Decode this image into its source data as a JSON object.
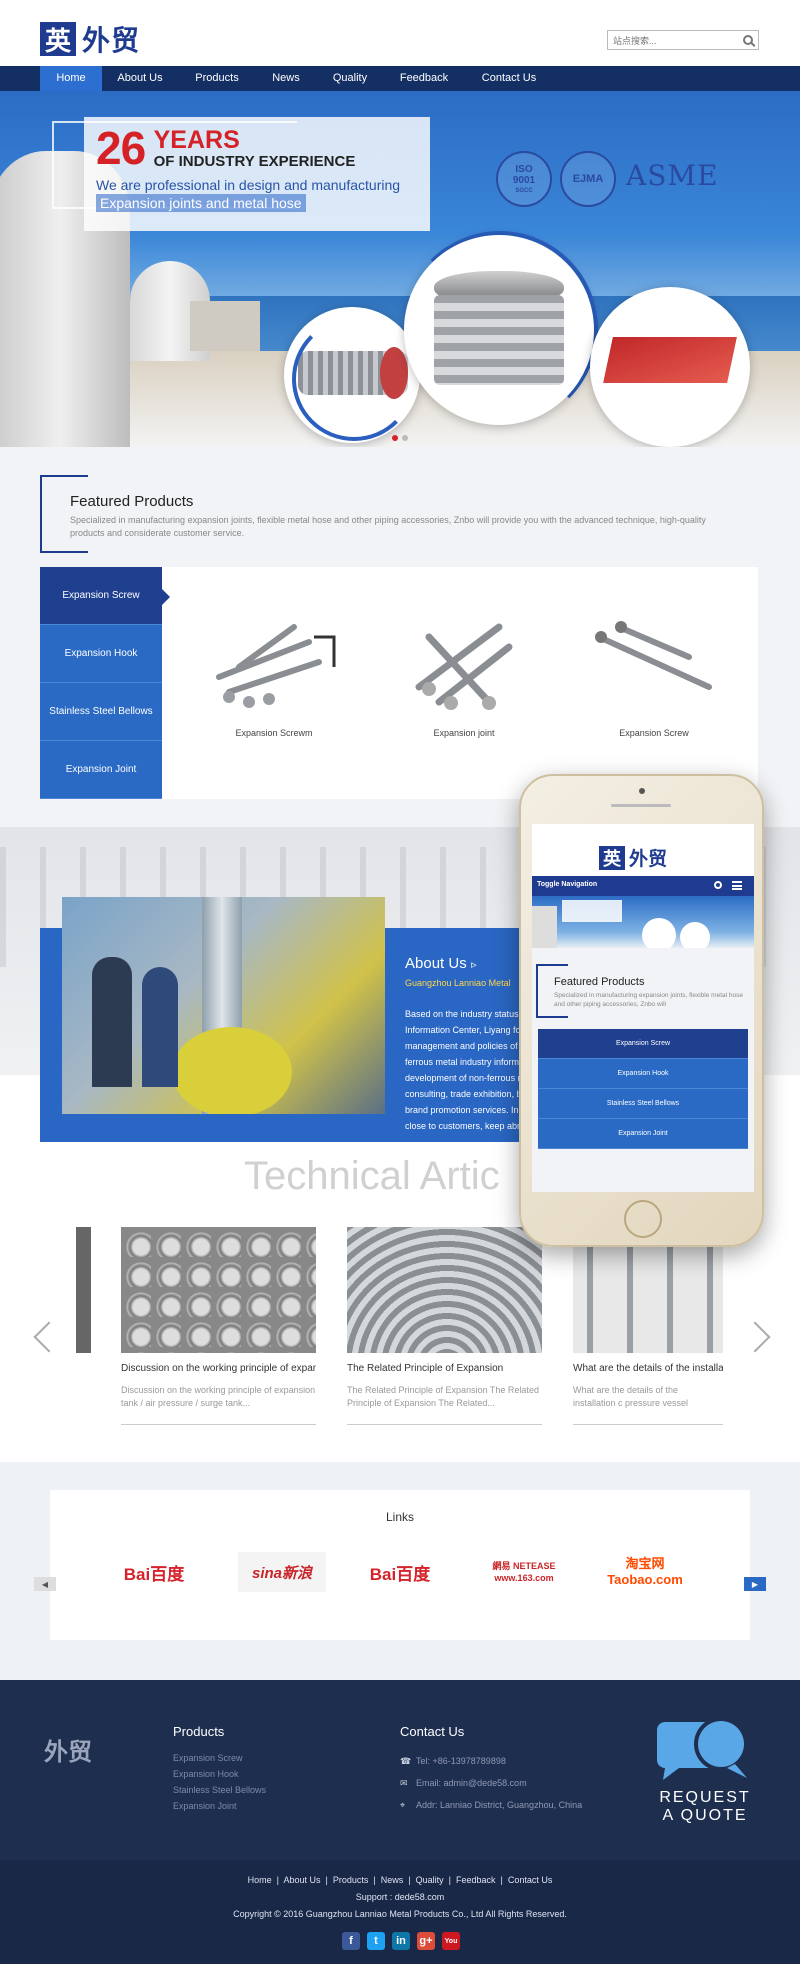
{
  "header": {
    "logo_char": "英",
    "logo_text": "外贸",
    "search_placeholder": "站点搜索..."
  },
  "nav": {
    "items": [
      {
        "label": "Home",
        "active": true
      },
      {
        "label": "About Us"
      },
      {
        "label": "Products"
      },
      {
        "label": "News"
      },
      {
        "label": "Quality"
      },
      {
        "label": "Feedback"
      },
      {
        "label": "Contact Us"
      }
    ]
  },
  "banner": {
    "years": "26",
    "years_word": "YEARS",
    "experience": "OF INDUSTRY EXPERIENCE",
    "line1": "We are professional in design and manufacturing",
    "line2": "Expansion joints and metal hose",
    "cert1": "ISO 9001",
    "cert1_sub": "SGCC",
    "cert2": "EJMA",
    "brand": "ASME"
  },
  "featured": {
    "title": "Featured Products",
    "description": "Specialized in manufacturing expansion joints, flexible metal hose and other piping accessories, Znbo will provide you with the advanced technique, high-quality products and considerate customer service.",
    "tabs": [
      "Expansion Screw",
      "Expansion Hook",
      "Stainless Steel Bellows",
      "Expansion Joint"
    ],
    "products": [
      "Expansion Screwm",
      "Expansion joint",
      "Expansion Screw"
    ]
  },
  "about": {
    "title": "About Us",
    "arrow": "▹",
    "subtitle": "Guangzhou Lanniao Metal",
    "lines": [
      "Based on the industry status a",
      "Information Center, Liyang fo",
      "management and policies of t",
      "ferrous metal industry informa",
      "development of non-ferrous m",
      "consulting, trade exhibition, b",
      "brand promotion services. In t",
      "close to customers, keep abre"
    ]
  },
  "technical": {
    "title": "Technical Artic",
    "articles": [
      {
        "title": "Discussion on the working principle of expansi",
        "desc": "Discussion on the working principle of expansion tank / air pressure / surge tank..."
      },
      {
        "title": "The Related Principle of Expansion",
        "desc": "The Related Principle of Expansion The Related Principle of Expansion The Related..."
      },
      {
        "title": "What are the details of the installatio",
        "desc": "What are the details of the installation c pressure vessel expansion joint? ..."
      }
    ]
  },
  "links": {
    "title": "Links",
    "logos": [
      "Bai百度",
      "sina新浪",
      "Bai百度",
      "網易 NETEASE www.163.com",
      "淘宝网 Taobao.com"
    ]
  },
  "footer": {
    "logo": "外贸",
    "products_title": "Products",
    "products": [
      "Expansion Screw",
      "Expansion Hook",
      "Stainless Steel Bellows",
      "Expansion Joint"
    ],
    "contact_title": "Contact Us",
    "tel": "Tel: +86-13978789898",
    "email": "Email: admin@dede58.com",
    "addr": "Addr: Lanniao District, Guangzhou, China",
    "quote1": "REQUEST",
    "quote2": "A QUOTE",
    "bottom_links": [
      "Home",
      "About Us",
      "Products",
      "News",
      "Quality",
      "Feedback",
      "Contact Us"
    ],
    "support": "Support : dede58.com",
    "copyright": "Copyright © 2016 Guangzhou Lanniao Metal Products Co., Ltd All Rights Reserved.",
    "social": [
      "f",
      "t",
      "in",
      "g+",
      "You"
    ]
  },
  "phone": {
    "logo_char": "英",
    "logo_text": "外贸",
    "toggle": "Toggle Navigation",
    "feat_title": "Featured Products",
    "feat_desc": "Specialized in manufacturing expansion joints, flexible metal hose and other piping accessories, Znbo will",
    "tabs": [
      "Expansion Screw",
      "Expansion Hook",
      "Stainless Steel Bellows",
      "Expansion Joint"
    ]
  },
  "colors": {
    "brand": "#1f3b8f",
    "nav": "#142f64",
    "accent": "#2a6ac5",
    "footer": "#1e2e4f"
  }
}
